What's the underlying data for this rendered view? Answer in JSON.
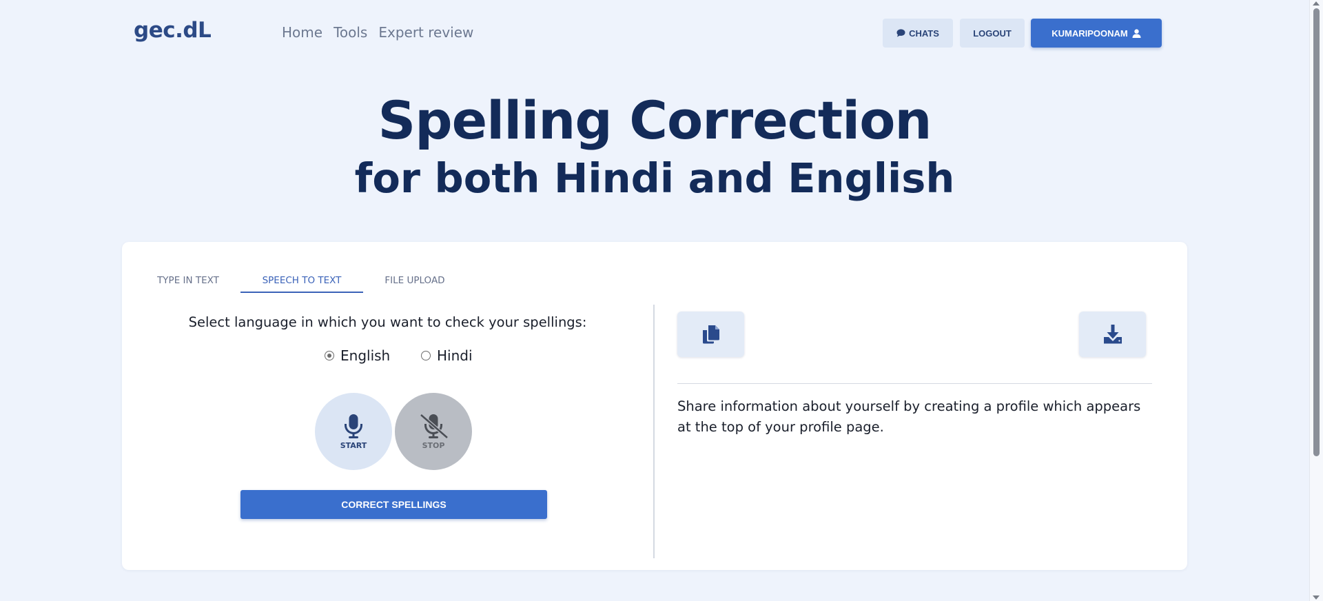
{
  "navbar": {
    "logo": "gec.dL",
    "links": [
      "Home",
      "Tools",
      "Expert review"
    ],
    "chats_label": "CHATS",
    "logout_label": "LOGOUT",
    "user_label": "KUMARIPOONAM"
  },
  "hero": {
    "title": "Spelling Correction",
    "subtitle": "for both Hindi and English"
  },
  "tabs": [
    {
      "label": "TYPE IN TEXT",
      "active": false
    },
    {
      "label": "SPEECH TO TEXT",
      "active": true
    },
    {
      "label": "FILE UPLOAD",
      "active": false
    }
  ],
  "speech_panel": {
    "language_prompt": "Select language in which you want to check your spellings:",
    "languages": [
      {
        "label": "English",
        "selected": true
      },
      {
        "label": "Hindi",
        "selected": false
      }
    ],
    "start_label": "START",
    "stop_label": "STOP",
    "correct_button": "CORRECT SPELLINGS"
  },
  "output_panel": {
    "copy_icon": "copy-icon",
    "download_icon": "download-icon",
    "text": "Share information about yourself by creating a profile which appears at the top of your profile page."
  },
  "colors": {
    "accent": "#3a6fcd",
    "background": "#eef3fc",
    "heading": "#132b59"
  }
}
